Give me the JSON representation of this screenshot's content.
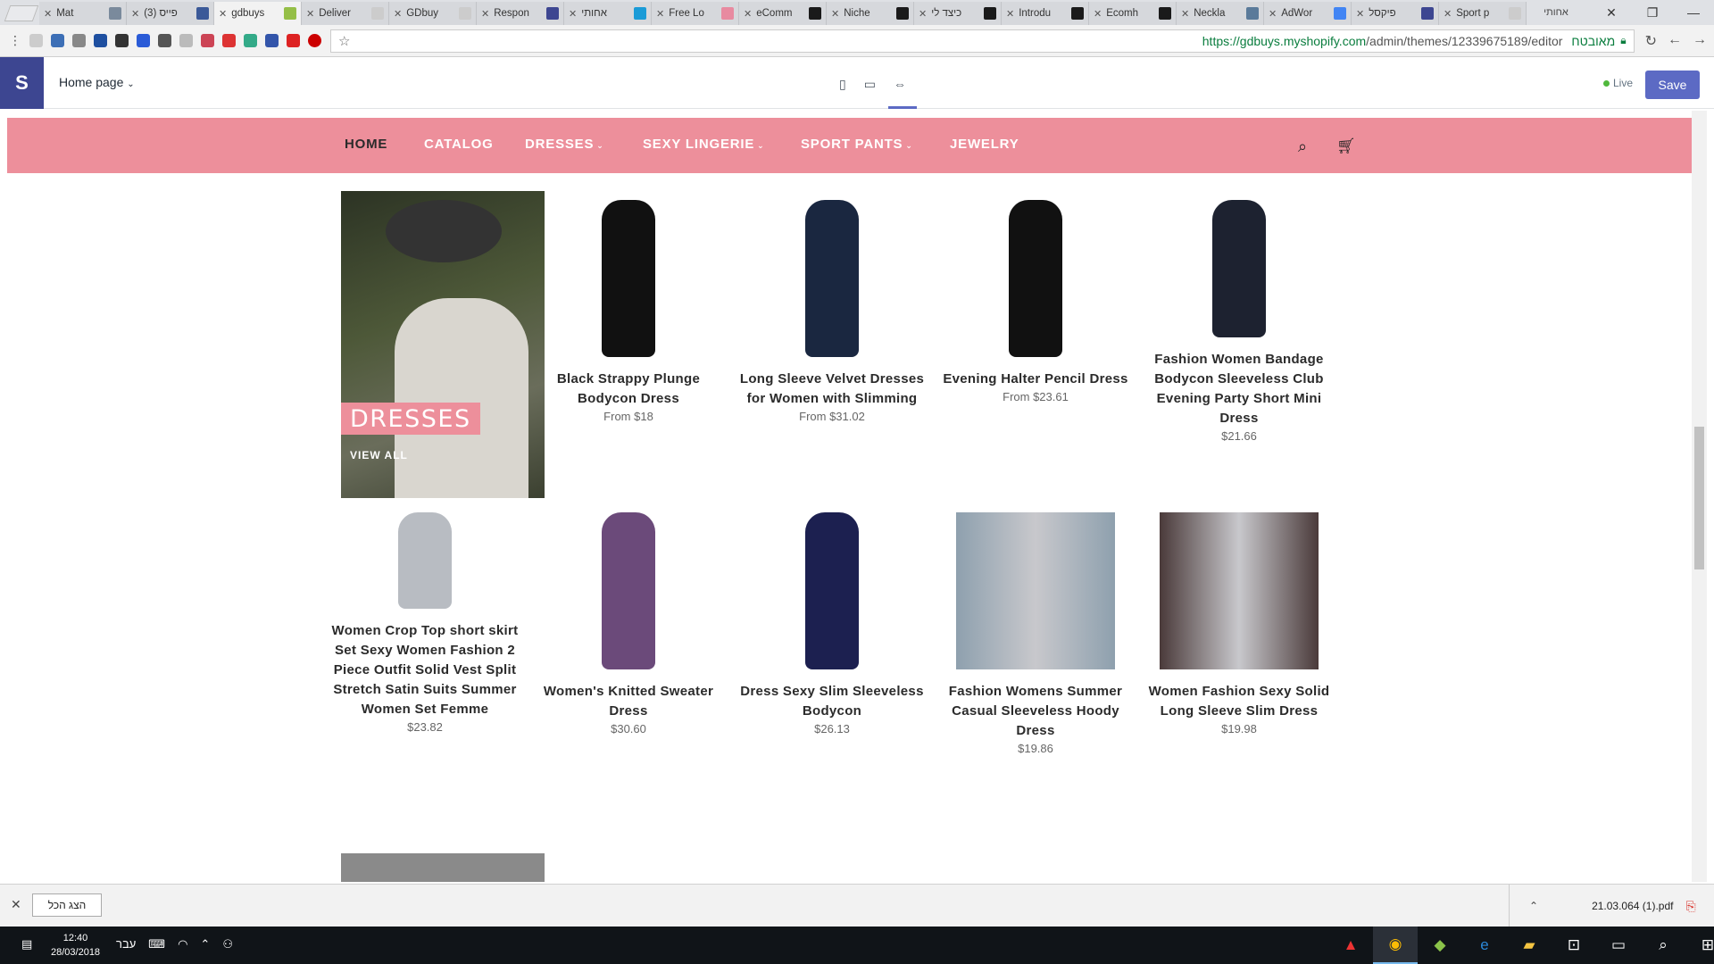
{
  "browser": {
    "tabs": [
      {
        "title": "Mat",
        "fav": "#7a8a9c"
      },
      {
        "title": "(3) פייס",
        "fav": "#3b5998"
      },
      {
        "title": "gdbuys",
        "fav": "#95bf47",
        "active": true
      },
      {
        "title": "Deliver",
        "fav": "#cccccc"
      },
      {
        "title": "GDbuy",
        "fav": "#cccccc"
      },
      {
        "title": "Respon",
        "fav": "#3d4691"
      },
      {
        "title": "אחותי",
        "fav": "#1a9bd7"
      },
      {
        "title": "Free Lo",
        "fav": "#e88aa0"
      },
      {
        "title": "eComm",
        "fav": "#1a1a1a"
      },
      {
        "title": "Niche",
        "fav": "#1a1a1a"
      },
      {
        "title": "כיצד לי",
        "fav": "#1a1a1a"
      },
      {
        "title": "Introdu",
        "fav": "#1a1a1a"
      },
      {
        "title": "Ecomh",
        "fav": "#1a1a1a"
      },
      {
        "title": "Neckla",
        "fav": "#5a7a9a"
      },
      {
        "title": "AdWor",
        "fav": "#4285f4"
      },
      {
        "title": "פיקסל",
        "fav": "#3d4691"
      },
      {
        "title": "Sport p",
        "fav": "#cccccc"
      }
    ],
    "profile_label": "אחותי",
    "window_controls": {
      "minimize": "—",
      "restore": "❐",
      "close": "✕"
    },
    "url_host": "https://gdbuys.myshopify.com",
    "url_path": "/admin/themes/12339675189/editor",
    "secure_label": "מאובטח"
  },
  "shopify": {
    "logo": "S",
    "page_selector": "Home page",
    "live_label": "Live",
    "save_label": "Save"
  },
  "store": {
    "nav": [
      {
        "label": "HOME",
        "dropdown": false
      },
      {
        "label": "CATALOG",
        "dropdown": false
      },
      {
        "label": "DRESSES",
        "dropdown": true
      },
      {
        "label": "SEXY LINGERIE",
        "dropdown": true
      },
      {
        "label": "SPORT PANTS",
        "dropdown": true
      },
      {
        "label": "JEWELRY",
        "dropdown": false
      }
    ],
    "collection_title": "DRESSES",
    "collection_link": "VIEW ALL",
    "products": [
      {
        "title": "Black Strappy Plunge Bodycon Dress",
        "price": "From $18"
      },
      {
        "title": "Long Sleeve Velvet Dresses for Women with Slimming",
        "price": "From $31.02"
      },
      {
        "title": "Evening Halter Pencil Dress",
        "price": "From $23.61"
      },
      {
        "title": "Fashion Women Bandage Bodycon Sleeveless Club Evening Party Short Mini Dress",
        "price": "$21.66"
      },
      {
        "title": "Women Crop Top short skirt Set Sexy Women Fashion 2 Piece Outfit Solid Vest Split Stretch Satin Suits Summer Women Set Femme",
        "price": "$23.82"
      },
      {
        "title": "Women's Knitted Sweater Dress",
        "price": "$30.60"
      },
      {
        "title": "Dress Sexy Slim Sleeveless Bodycon",
        "price": "$26.13"
      },
      {
        "title": "Fashion Womens Summer Casual Sleeveless Hoody Dress",
        "price": "$19.86"
      },
      {
        "title": "Women Fashion Sexy Solid Long Sleeve Slim Dress",
        "price": "$19.98"
      }
    ]
  },
  "downloads": {
    "show_all": "הצג הכל",
    "file": "21.03.064 (1).pdf"
  },
  "taskbar": {
    "time": "12:40",
    "date": "28/03/2018",
    "lang": "עבר"
  },
  "colors": {
    "accent": "#5c6ac4",
    "store_nav": "#ed8f9b"
  }
}
